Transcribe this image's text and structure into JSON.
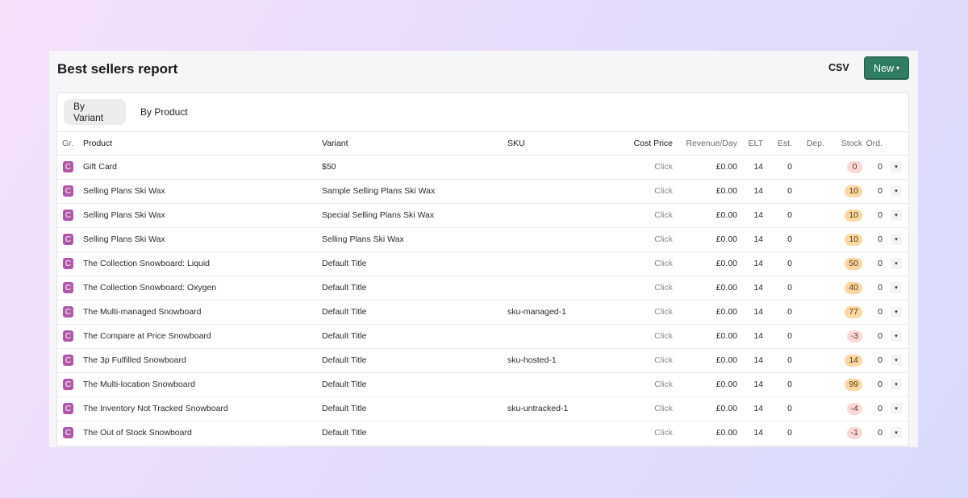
{
  "header": {
    "title": "Best sellers report",
    "csv_label": "CSV",
    "new_label": "New",
    "new_caret": "▾"
  },
  "colors": {
    "accent": "#2e7d63",
    "group_badge": "#b058a8",
    "stock_low": "#f9d9d6",
    "stock_ok": "#fbd9a2"
  },
  "tabs": [
    {
      "label": "By Variant",
      "active": true
    },
    {
      "label": "By Product",
      "active": false
    }
  ],
  "table": {
    "columns": {
      "group": "Gr.",
      "product": "Product",
      "variant": "Variant",
      "sku": "SKU",
      "cost_price": "Cost Price",
      "revenue_day": "Revenue/Day",
      "elt": "ELT",
      "est": "Est.",
      "dep": "Dep.",
      "stock": "Stock",
      "ord": "Ord."
    },
    "rows": [
      {
        "group": "C",
        "product": "Gift Card",
        "variant": "$50",
        "sku": "",
        "cost_price": "Click",
        "revenue_day": "£0.00",
        "elt": "14",
        "est": "0",
        "dep": "",
        "stock": "0",
        "stock_level": "red",
        "ord": "0"
      },
      {
        "group": "C",
        "product": "Selling Plans Ski Wax",
        "variant": "Sample Selling Plans Ski Wax",
        "sku": "",
        "cost_price": "Click",
        "revenue_day": "£0.00",
        "elt": "14",
        "est": "0",
        "dep": "",
        "stock": "10",
        "stock_level": "orange",
        "ord": "0"
      },
      {
        "group": "C",
        "product": "Selling Plans Ski Wax",
        "variant": "Special Selling Plans Ski Wax",
        "sku": "",
        "cost_price": "Click",
        "revenue_day": "£0.00",
        "elt": "14",
        "est": "0",
        "dep": "",
        "stock": "10",
        "stock_level": "orange",
        "ord": "0"
      },
      {
        "group": "C",
        "product": "Selling Plans Ski Wax",
        "variant": "Selling Plans Ski Wax",
        "sku": "",
        "cost_price": "Click",
        "revenue_day": "£0.00",
        "elt": "14",
        "est": "0",
        "dep": "",
        "stock": "10",
        "stock_level": "orange",
        "ord": "0"
      },
      {
        "group": "C",
        "product": "The Collection Snowboard: Liquid",
        "variant": "Default Title",
        "sku": "",
        "cost_price": "Click",
        "revenue_day": "£0.00",
        "elt": "14",
        "est": "0",
        "dep": "",
        "stock": "50",
        "stock_level": "orange",
        "ord": "0"
      },
      {
        "group": "C",
        "product": "The Collection Snowboard: Oxygen",
        "variant": "Default Title",
        "sku": "",
        "cost_price": "Click",
        "revenue_day": "£0.00",
        "elt": "14",
        "est": "0",
        "dep": "",
        "stock": "40",
        "stock_level": "orange",
        "ord": "0"
      },
      {
        "group": "C",
        "product": "The Multi-managed Snowboard",
        "variant": "Default Title",
        "sku": "sku-managed-1",
        "cost_price": "Click",
        "revenue_day": "£0.00",
        "elt": "14",
        "est": "0",
        "dep": "",
        "stock": "77",
        "stock_level": "orange",
        "ord": "0"
      },
      {
        "group": "C",
        "product": "The Compare at Price Snowboard",
        "variant": "Default Title",
        "sku": "",
        "cost_price": "Click",
        "revenue_day": "£0.00",
        "elt": "14",
        "est": "0",
        "dep": "",
        "stock": "-3",
        "stock_level": "red",
        "ord": "0"
      },
      {
        "group": "C",
        "product": "The 3p Fulfilled Snowboard",
        "variant": "Default Title",
        "sku": "sku-hosted-1",
        "cost_price": "Click",
        "revenue_day": "£0.00",
        "elt": "14",
        "est": "0",
        "dep": "",
        "stock": "14",
        "stock_level": "orange",
        "ord": "0"
      },
      {
        "group": "C",
        "product": "The Multi-location Snowboard",
        "variant": "Default Title",
        "sku": "",
        "cost_price": "Click",
        "revenue_day": "£0.00",
        "elt": "14",
        "est": "0",
        "dep": "",
        "stock": "99",
        "stock_level": "orange",
        "ord": "0"
      },
      {
        "group": "C",
        "product": "The Inventory Not Tracked Snowboard",
        "variant": "Default Title",
        "sku": "sku-untracked-1",
        "cost_price": "Click",
        "revenue_day": "£0.00",
        "elt": "14",
        "est": "0",
        "dep": "",
        "stock": "-4",
        "stock_level": "red",
        "ord": "0"
      },
      {
        "group": "C",
        "product": "The Out of Stock Snowboard",
        "variant": "Default Title",
        "sku": "",
        "cost_price": "Click",
        "revenue_day": "£0.00",
        "elt": "14",
        "est": "0",
        "dep": "",
        "stock": "-1",
        "stock_level": "red",
        "ord": "0"
      }
    ],
    "row_menu_icon": "▾"
  }
}
